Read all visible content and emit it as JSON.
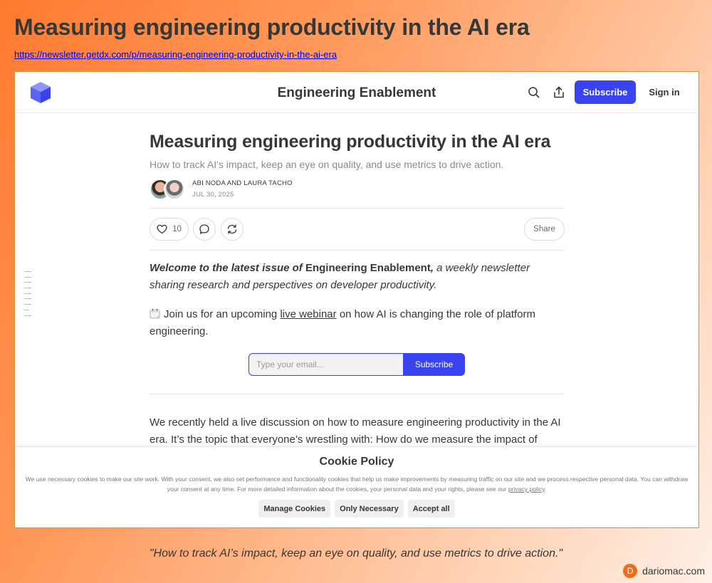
{
  "page": {
    "heading": "Measuring engineering productivity in the AI era",
    "link": "https://newsletter.getdx.com/p/measuring-engineering-productivity-in-the-ai-era",
    "quote": "\"How to track AI’s impact, keep an eye on quality, and use metrics to drive action.\"",
    "brand": {
      "initial": "D",
      "name": "dariomac.com"
    }
  },
  "header": {
    "logo_icon": "cube-logo-icon",
    "site_title": "Engineering Enablement",
    "search_icon": "search-icon",
    "share_icon": "share-upload-icon",
    "subscribe_label": "Subscribe",
    "signin_label": "Sign in",
    "accent_color": "#3a43f0"
  },
  "article": {
    "title": "Measuring engineering productivity in the AI era",
    "subtitle": "How to track AI's impact, keep an eye on quality, and use metrics to drive action.",
    "authors": "ABI NODA AND LAURA TACHO",
    "date": "JUL 30, 2025",
    "actions": {
      "like_icon": "heart-icon",
      "like_count": "10",
      "comment_icon": "comment-icon",
      "restack_icon": "restack-icon",
      "share_label": "Share"
    },
    "intro": {
      "lead": "Welcome to the latest issue of ",
      "name": "Engineering Enablement",
      "comma": ",",
      "rest": " a weekly newsletter sharing research and perspectives on developer productivity."
    },
    "webinar": {
      "icon": "calendar-icon",
      "before": "Join us for an upcoming ",
      "link": "live webinar",
      "after": " on how AI is changing the role of platform engineering."
    },
    "form": {
      "placeholder": "Type your email...",
      "button": "Subscribe"
    },
    "body": "We recently held a live discussion on how to measure engineering productivity in the AI era. It’s the topic that everyone’s wrestling with: How do we measure the impact of"
  },
  "cookie": {
    "title": "Cookie Policy",
    "text": "We use necessary cookies to make our site work. With your consent, we also set performance and functionality cookies that help us make improvements by measuring traffic on our site and we process respective personal data. You can withdraw your consent at any time. For more detailed information about the cookies, your personal data and your rights, please see our ",
    "link": "privacy policy",
    "end": ".",
    "buttons": [
      "Manage Cookies",
      "Only Necessary",
      "Accept all"
    ]
  }
}
